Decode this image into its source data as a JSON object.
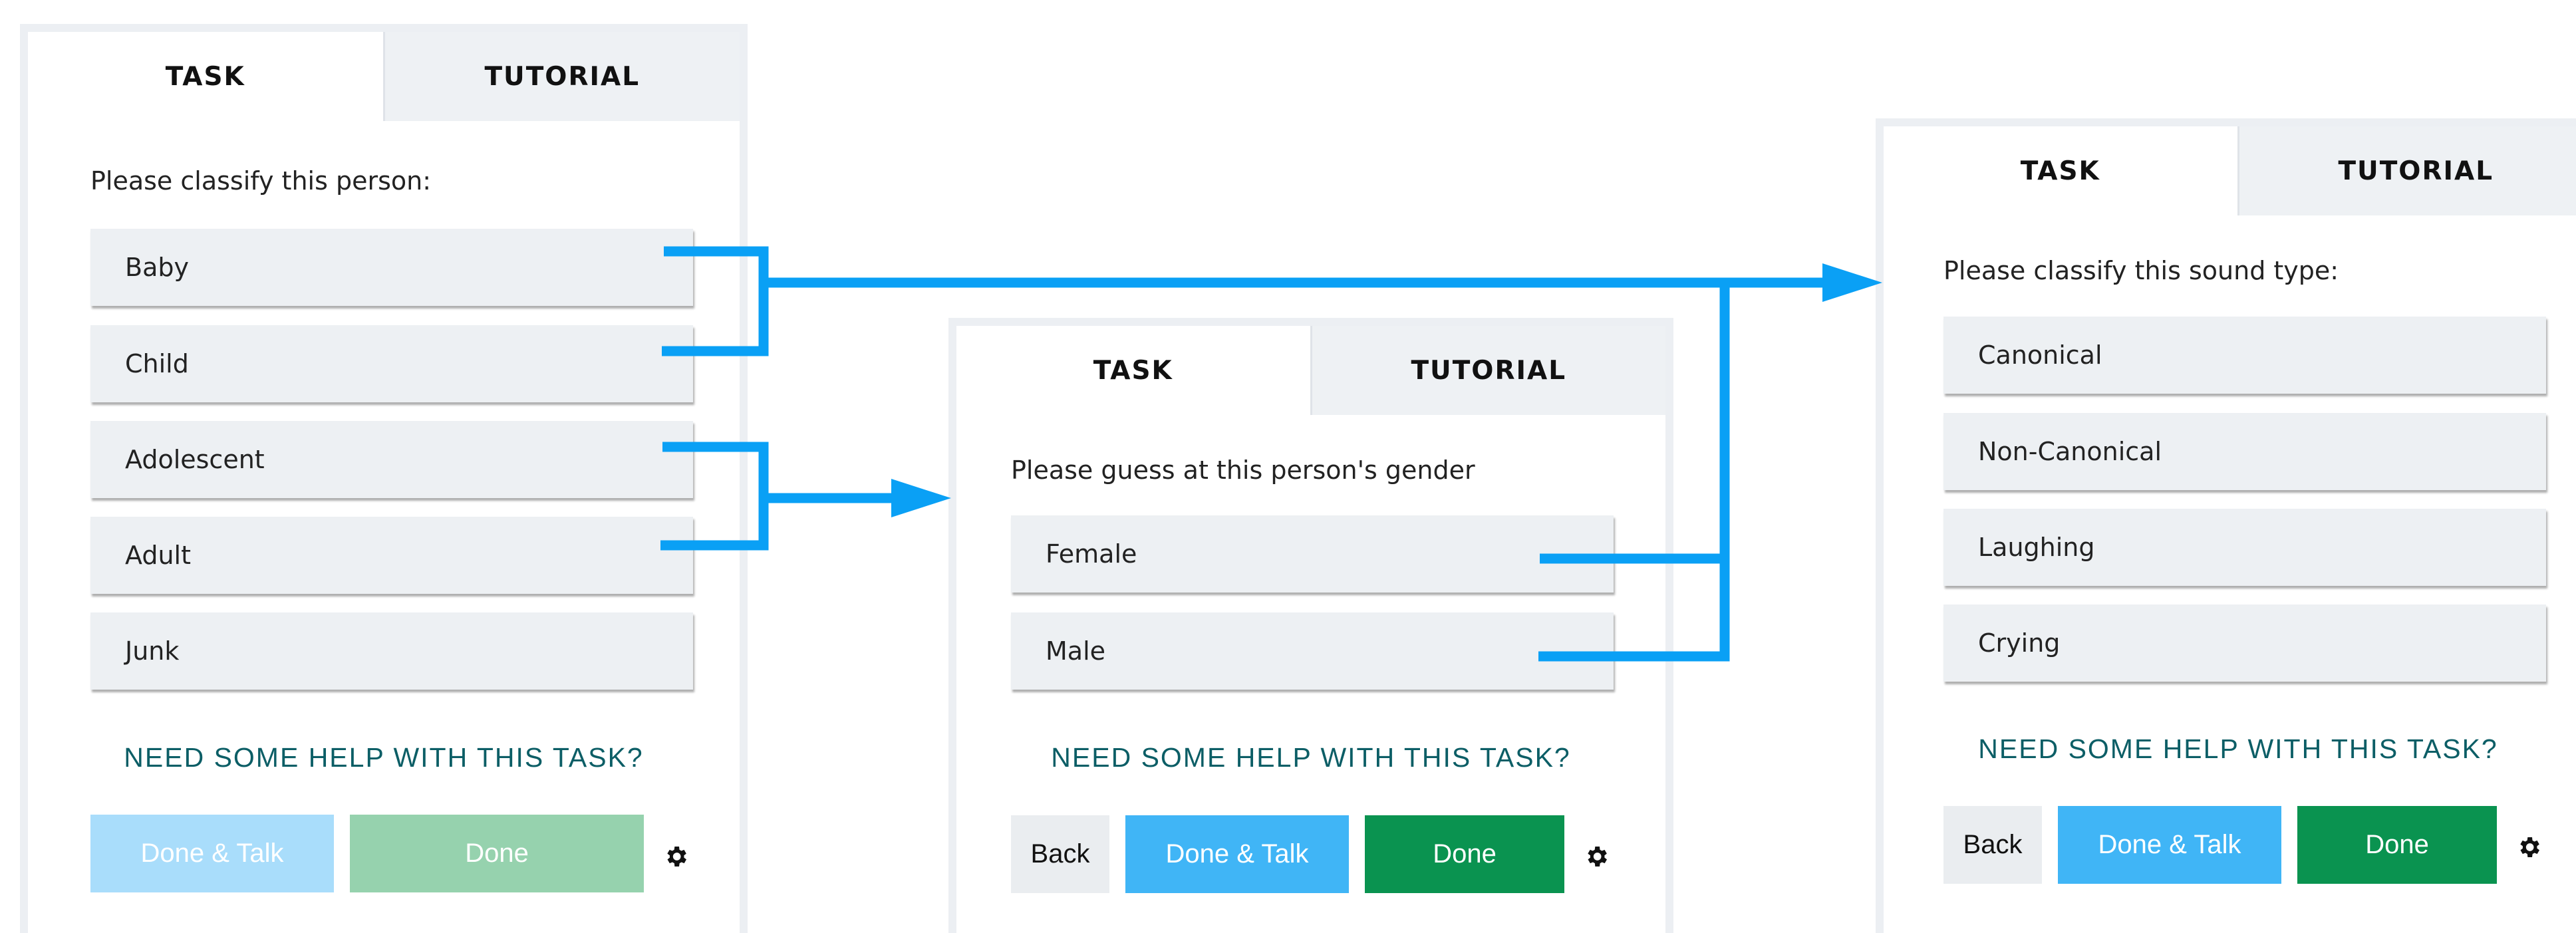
{
  "colors": {
    "connector": "#0aa0f5",
    "help_text": "#0c5e66",
    "done_talk": "#40b5f6",
    "done": "#0a9350",
    "done_talk_disabled": "#a9ddfb",
    "done_disabled": "#96d2ae"
  },
  "panels": [
    {
      "tabs": [
        "TASK",
        "TUTORIAL"
      ],
      "question": "Please classify this person:",
      "answers": [
        "Baby",
        "Child",
        "Adolescent",
        "Adult",
        "Junk"
      ],
      "help": "NEED SOME HELP WITH THIS TASK?",
      "buttons": {
        "talk": "Done & Talk",
        "done": "Done"
      },
      "gear_icon": "gear-icon"
    },
    {
      "tabs": [
        "TASK",
        "TUTORIAL"
      ],
      "question": "Please guess at this person's gender",
      "answers": [
        "Female",
        "Male"
      ],
      "help": "NEED SOME HELP WITH THIS TASK?",
      "buttons": {
        "back": "Back",
        "talk": "Done & Talk",
        "done": "Done"
      },
      "gear_icon": "gear-icon"
    },
    {
      "tabs": [
        "TASK",
        "TUTORIAL"
      ],
      "question": "Please classify this sound type:",
      "answers": [
        "Canonical",
        "Non-Canonical",
        "Laughing",
        "Crying"
      ],
      "help": "NEED SOME HELP WITH THIS TASK?",
      "buttons": {
        "back": "Back",
        "talk": "Done & Talk",
        "done": "Done"
      },
      "gear_icon": "gear-icon"
    }
  ]
}
